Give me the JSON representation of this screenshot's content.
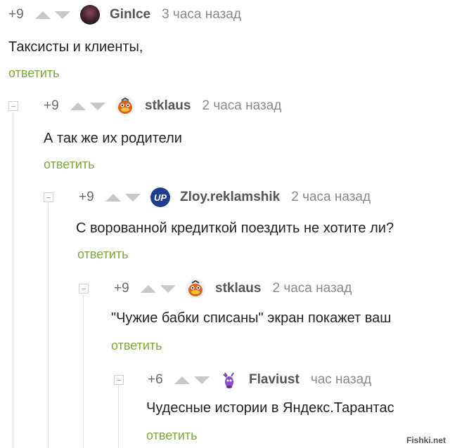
{
  "comments": [
    {
      "score": "+9",
      "author": "GinIce",
      "time": "3 часа назад",
      "text": "Таксисты и клиенты,",
      "reply": "ответить",
      "avatar": "dark-face-avatar"
    },
    {
      "score": "+9",
      "author": "stklaus",
      "time": "2 часа назад",
      "text": "А так же их родители",
      "reply": "ответить",
      "avatar": "cartoon-bird-avatar"
    },
    {
      "score": "+9",
      "author": "Zloy.reklamshik",
      "time": "2 часа назад",
      "text": "С ворованной кредиткой поездить не хотите ли?",
      "reply": "ответить",
      "avatar": "up-logo-avatar",
      "avatar_text": "UP"
    },
    {
      "score": "+9",
      "author": "stklaus",
      "time": "2 часа назад",
      "text": "\"Чужие бабки списаны\" экран покажет ваш",
      "reply": "ответить",
      "avatar": "cartoon-bird-avatar"
    },
    {
      "score": "+6",
      "author": "Flaviust",
      "time": "час назад",
      "text": "Чудесные истории в Яндекс.Тарантас",
      "reply": "ответить",
      "avatar": "purple-creature-avatar"
    }
  ],
  "watermark": "Fishki.net",
  "colors": {
    "reply": "#7aa83c",
    "arrow": "#c8c8c8",
    "author": "#555555"
  }
}
